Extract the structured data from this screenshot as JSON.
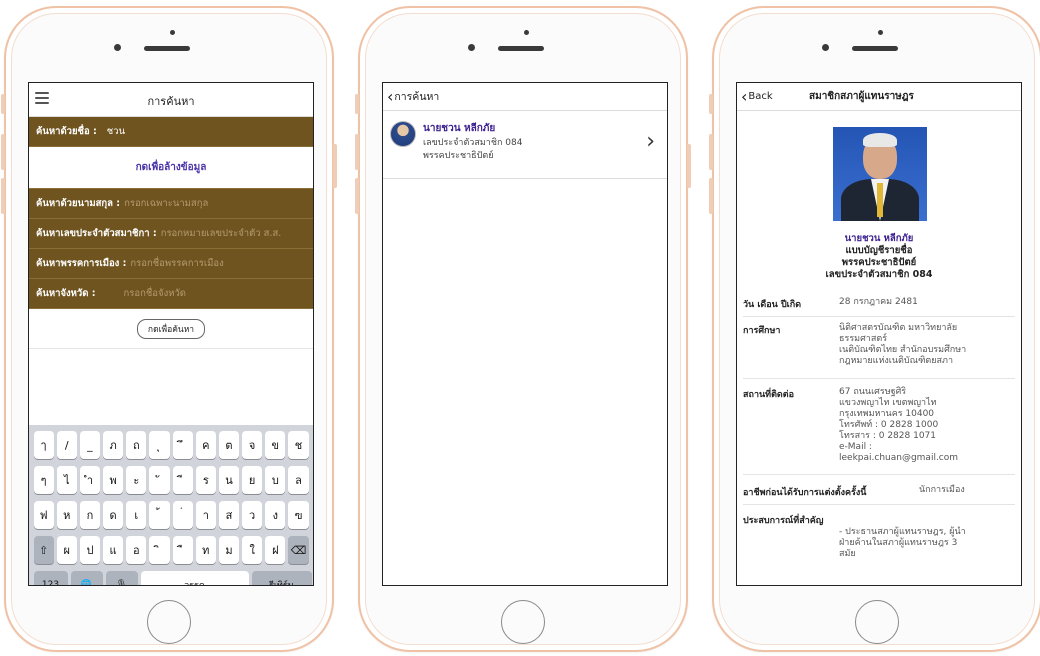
{
  "screen1": {
    "title": "การค้นหา",
    "name_row": {
      "label": "ค้นหาด้วยชื่อ :",
      "value": "ชวน"
    },
    "clear_label": "กดเพื่อล้างข้อมูล",
    "surname_row": {
      "label": "ค้นหาด้วยนามสกุล :",
      "placeholder": "กรอกเฉพาะนามสกุล"
    },
    "member_no_row": {
      "label": "ค้นหาเลขประจำตัวสมาชิกา :",
      "placeholder": "กรอกหมายเลขประจำตัว ส.ส."
    },
    "party_row": {
      "label": "ค้นหาพรรคการเมือง :",
      "placeholder": "กรอกชื่อพรรคการเมือง"
    },
    "province_row": {
      "label": "ค้นหาจังหวัด :",
      "placeholder": "กรอกชื่อจังหวัด"
    },
    "search_button": "กดเพื่อค้นหา",
    "keyboard": {
      "row1": [
        "ๅ",
        "/",
        "_",
        "ภ",
        "ถ",
        "ุ",
        "ึ",
        "ค",
        "ต",
        "จ",
        "ข",
        "ช"
      ],
      "row2": [
        "ๆ",
        "ไ",
        "ำ",
        "พ",
        "ะ",
        "ั",
        "ี",
        "ร",
        "น",
        "ย",
        "บ",
        "ล"
      ],
      "row3": [
        "ฟ",
        "ห",
        "ก",
        "ด",
        "เ",
        "้",
        "่",
        "า",
        "ส",
        "ว",
        "ง",
        "ฃ"
      ],
      "row4": [
        "ผ",
        "ป",
        "แ",
        "อ",
        "ิ",
        "ื",
        "ท",
        "ม",
        "ใ",
        "ฝ"
      ],
      "shift": "⇧",
      "delete": "⌫",
      "numbers": "123",
      "globe": "🌐",
      "mic": "🎙",
      "space": "วรรค",
      "return": "รีเทิร์น"
    }
  },
  "screen2": {
    "back_label": "การค้นหา",
    "result": {
      "name": "นายชวน หลีกภัย",
      "member_no": "เลขประจำตัวสมาชิก 084",
      "party": "พรรคประชาธิปัตย์"
    }
  },
  "screen3": {
    "back_label": "Back",
    "title": "สมาชิกสภาผู้แทนราษฎร",
    "name": "นายชวน หลีกภัย",
    "list_type": "แบบบัญชีรายชื่อ",
    "party": "พรรคประชาธิปัตย์",
    "member_no": "เลขประจำตัวสมาชิก 084",
    "birth": {
      "label": "วัน เดือน ปีเกิด",
      "value": "28 กรกฎาคม 2481"
    },
    "education": {
      "label": "การศึกษา",
      "lines": [
        "นิติศาสตรบัณฑิต มหาวิทยาลัย",
        "ธรรมศาสตร์",
        "เนติบัณฑิตไทย สำนักอบรมศึกษา",
        "กฎหมายแห่งเนติบัณฑิตยสภา"
      ]
    },
    "address": {
      "label": "สถานที่ติดต่อ",
      "lines": [
        "67 ถนนเศรษฐศิริ",
        "แขวงพญาไท เขตพญาไท",
        "กรุงเทพมหานคร 10400",
        "โทรศัพท์ : 0 2828 1000",
        "โทรสาร : 0 2828 1071",
        "e-Mail :",
        "leekpai.chuan@gmail.com"
      ]
    },
    "occupation": {
      "label": "อาชีพก่อนได้รับการแต่งตั้งครั้งนี้",
      "value": "นักการเมือง"
    },
    "experience": {
      "label": "ประสบการณ์ที่สำคัญ",
      "lines": [
        "- ประธานสภาผู้แทนราษฎร, ผู้นำ",
        "ฝ่ายค้านในสภาผู้แทนราษฎร 3",
        "สมัย"
      ]
    }
  }
}
